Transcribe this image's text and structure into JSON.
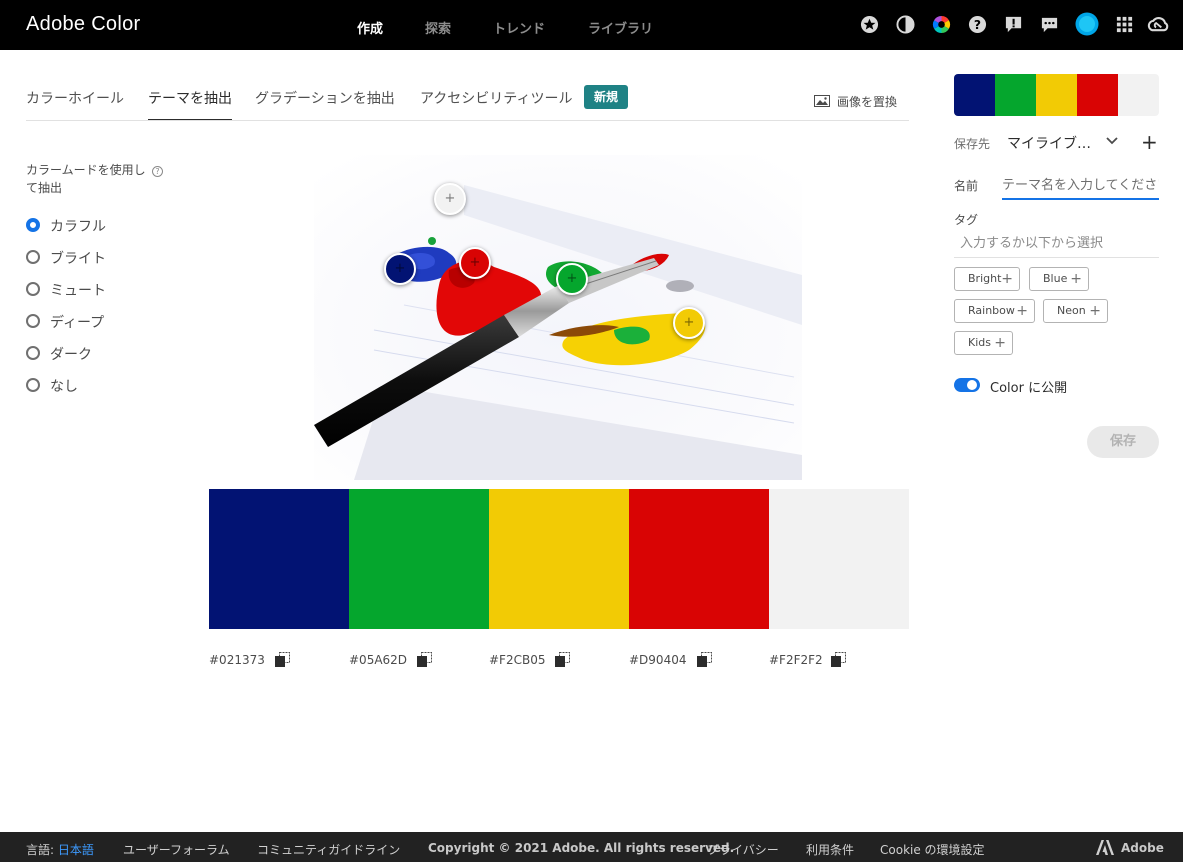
{
  "app": {
    "title": "Adobe Color"
  },
  "topnav": [
    {
      "label": "作成",
      "active": true
    },
    {
      "label": "探索",
      "active": false
    },
    {
      "label": "トレンド",
      "active": false
    },
    {
      "label": "ライブラリ",
      "active": false
    }
  ],
  "toolbar_icons": [
    "star-icon",
    "contrast-icon",
    "color-wheel-icon",
    "help-icon",
    "feedback-icon",
    "chat-icon",
    "user-avatar",
    "apps-grid-icon",
    "creative-cloud-icon"
  ],
  "tabs": [
    {
      "label": "カラーホイール",
      "active": false
    },
    {
      "label": "テーマを抽出",
      "active": true
    },
    {
      "label": "グラデーションを抽出",
      "active": false
    },
    {
      "label": "アクセシビリティツール",
      "active": false
    }
  ],
  "badge_new": "新規",
  "replace_image": "画像を置換",
  "mode": {
    "title": "カラームードを使用して抽出",
    "help": "?",
    "options": [
      {
        "label": "カラフル",
        "selected": true
      },
      {
        "label": "ブライト",
        "selected": false
      },
      {
        "label": "ミュート",
        "selected": false
      },
      {
        "label": "ディープ",
        "selected": false
      },
      {
        "label": "ダーク",
        "selected": false
      },
      {
        "label": "なし",
        "selected": false
      }
    ]
  },
  "swatches": [
    {
      "hex": "#021373",
      "label": "#021373"
    },
    {
      "hex": "#05A62D",
      "label": "#05A62D"
    },
    {
      "hex": "#F2CB05",
      "label": "#F2CB05"
    },
    {
      "hex": "#D90404",
      "label": "#D90404"
    },
    {
      "hex": "#F2F2F2",
      "label": "#F2F2F2"
    }
  ],
  "picker_symbol": "+",
  "sidebar": {
    "save_to_label": "保存先",
    "library_value": "マイライブ…",
    "add_symbol": "+",
    "name_label": "名前",
    "name_placeholder": "テーマ名を入力してください",
    "tag_label": "タグ",
    "tag_placeholder": "入力するか以下から選択",
    "tags": [
      {
        "label": "Bright",
        "plus": "+"
      },
      {
        "label": "Blue",
        "plus": "+"
      },
      {
        "label": "Rainbow",
        "plus": "+"
      },
      {
        "label": "Neon",
        "plus": "+"
      },
      {
        "label": "Kids",
        "plus": "+"
      }
    ],
    "publish_label": "Color に公開",
    "publish_on": true,
    "save_label": "保存"
  },
  "footer": {
    "language_label": "言語:",
    "language_value": "日本語",
    "forum": "ユーザーフォーラム",
    "guidelines": "コミュニティガイドライン",
    "copyright": "Copyright © 2021 Adobe. All rights reserved.",
    "privacy": "プライバシー",
    "terms": "利用条件",
    "cookies": "Cookie の環境設定",
    "adobe": "Adobe"
  },
  "colors": {
    "accent": "#1473e6",
    "badge": "#1f8285",
    "topbar": "#000000",
    "footer": "#222222"
  }
}
